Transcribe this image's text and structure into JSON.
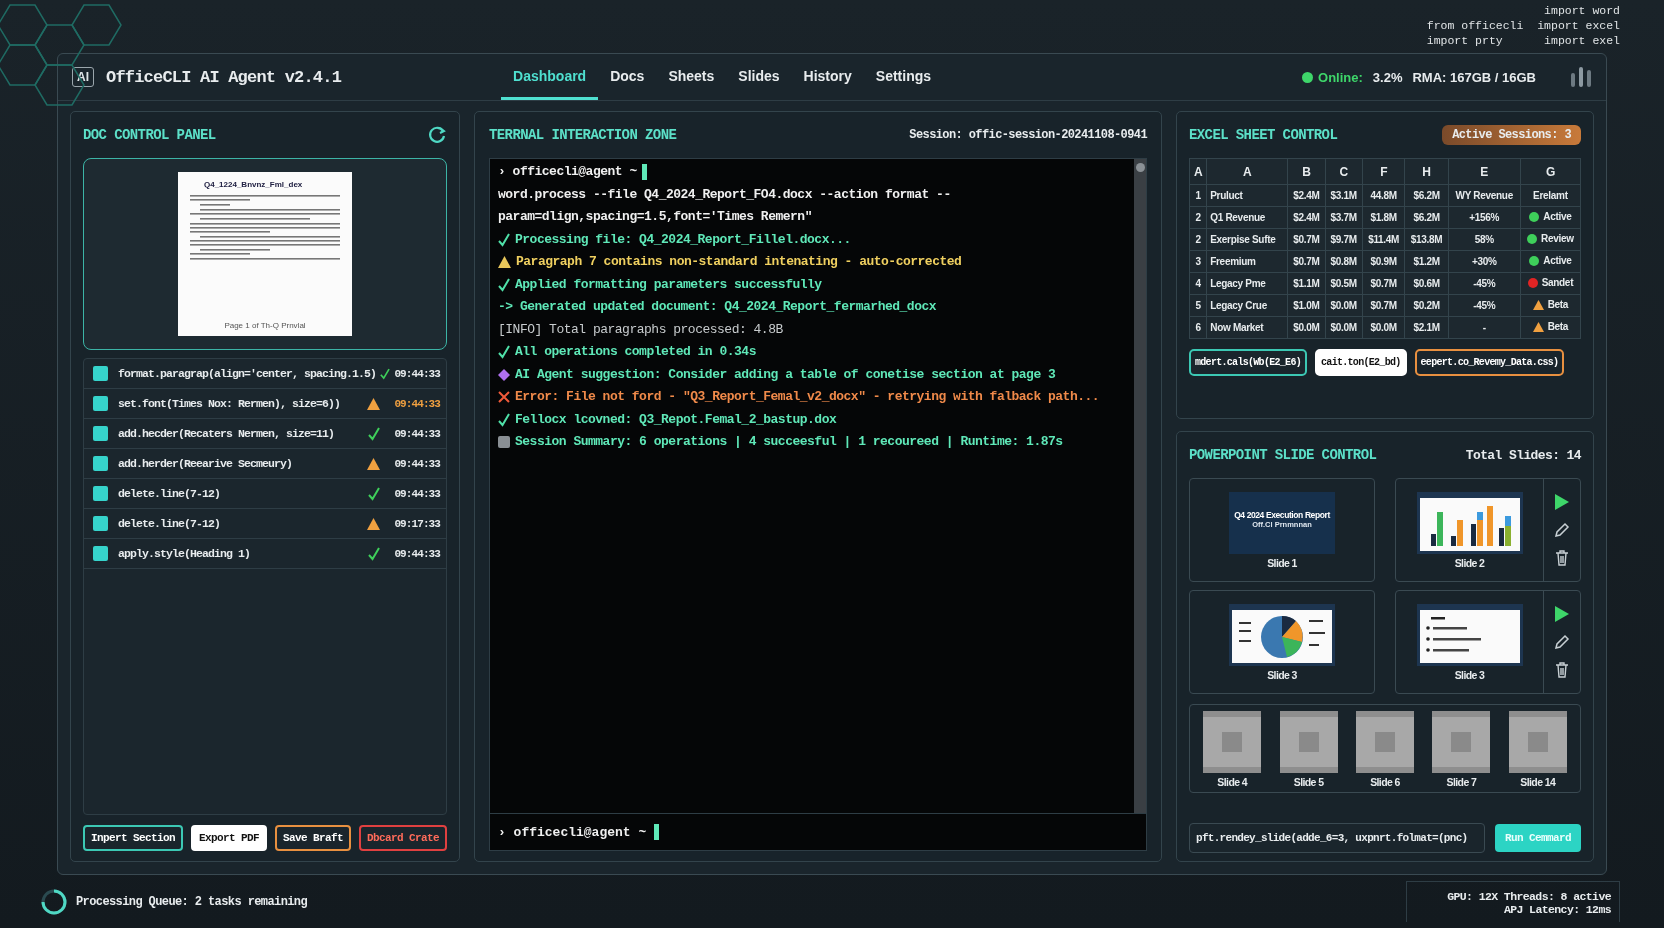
{
  "code_snippet": [
    "import word",
    "from officecli  import excel",
    "import prty      import exel"
  ],
  "header": {
    "logo": "AI",
    "title": "OfficeCLI AI Agent v2.4.1",
    "tabs": [
      {
        "label": "Dashboard",
        "selected": true
      },
      {
        "label": "Docs",
        "selected": false
      },
      {
        "label": "Sheets",
        "selected": false
      },
      {
        "label": "Slides",
        "selected": false
      },
      {
        "label": "History",
        "selected": false
      },
      {
        "label": "Settings",
        "selected": false
      }
    ],
    "status": {
      "online": true,
      "label": "Online:",
      "cpu": "3.2%",
      "ram": "RMA: 167GB / 16GB"
    }
  },
  "doc_panel": {
    "title": "DOC CONTROL PANEL",
    "preview": {
      "title": "Q4_1224_Bnvnz_Fml_dex",
      "footer": "Page 1 of Th-Q Prnvlal"
    },
    "operations": [
      {
        "command": "format.paragrap(align='center, spacing.1.5)",
        "kind": "success",
        "time": "09:44:33",
        "highlighted": false
      },
      {
        "command": "set.font(Times Nox: Rermen), size=6))",
        "kind": "warning",
        "time": "09:44:33",
        "highlighted": true
      },
      {
        "command": "add.hecder(Recaters Nermen, size=11)",
        "kind": "success",
        "time": "09:44:33",
        "highlighted": false
      },
      {
        "command": "add.herder(Reearive Secmeury)",
        "kind": "warning",
        "time": "09:44:33",
        "highlighted": false
      },
      {
        "command": "delete.line(7-12)",
        "kind": "success",
        "time": "09:44:33",
        "highlighted": false
      },
      {
        "command": "delete.line(7-12)",
        "kind": "warning",
        "time": "09:17:33",
        "highlighted": false
      },
      {
        "command": "apply.style(Heading 1)",
        "kind": "success",
        "time": "09:44:33",
        "highlighted": false
      }
    ],
    "buttons": [
      {
        "label": "Inpert Section",
        "kind": "teal"
      },
      {
        "label": "Export PDF",
        "kind": "white"
      },
      {
        "label": "Save Braft",
        "kind": "orange"
      },
      {
        "label": "Dbcard Crate",
        "kind": "red"
      }
    ]
  },
  "terminal": {
    "title": "TERRNAL INTERACTION ZONE",
    "session": "Session: offic-session-20241108-0941",
    "prompt": "› officecli@agent ~",
    "lines": [
      {
        "kind": "command",
        "text": "word.process --file Q4_2024_Report_FO4.docx --action format --param=dlign,spacing=1.5,font='Times Remern\""
      },
      {
        "kind": "success",
        "text": "Processing file: Q4_2024_Report_Fillel.docx..."
      },
      {
        "kind": "warning",
        "text": "Paragraph 7 contains non-standard intenating - auto-corrected"
      },
      {
        "kind": "success",
        "text": "Applied formatting parameters successfully"
      },
      {
        "kind": "arrow",
        "text": "-> Generated updated document: Q4_2024_Report_fermarhed_docx"
      },
      {
        "kind": "info",
        "text": "[INFO] Total paragraphs processed: 4.8B"
      },
      {
        "kind": "success",
        "text": "All operations completed in 0.34s"
      },
      {
        "kind": "suggestion",
        "text": "AI Agent suggestion: Consider adding a table of conetise section at page 3"
      },
      {
        "kind": "error",
        "text": "Error: File not ford - \"Q3_Report_Femal_v2_docx\" - retrying with falback path..."
      },
      {
        "kind": "success",
        "text": "Fellocx lcovned: Q3_Repot.Femal_2_bastup.dox"
      },
      {
        "kind": "summary",
        "text": "Session Summary: 6 operations | 4 succeesful | 1 recoureed  | Runtime: 1.87s"
      }
    ],
    "bottom_prompt": "› officecli@agent ~"
  },
  "excel_panel": {
    "title": "EXCEL SHEET CONTROL",
    "badge": "Active Sessions:  3",
    "columns": [
      "A",
      "A",
      "B",
      "C",
      "F",
      "H",
      "E",
      "G"
    ],
    "rows": [
      {
        "cells": [
          "1",
          "Pruluct",
          "$2.4M",
          "$3.1M",
          "44.8M",
          "$6.2M",
          "WY Revenue"
        ],
        "status": {
          "label": "Erelamt",
          "kind": "none"
        }
      },
      {
        "cells": [
          "2",
          "Q1 Revenue",
          "$2.4M",
          "$3.7M",
          "$1.8M",
          "$6.2M",
          "+156%"
        ],
        "status": {
          "label": "Active",
          "kind": "dot",
          "color": "#3ecf5a"
        }
      },
      {
        "cells": [
          "2",
          "Exerpise Sufte",
          "$0.7M",
          "$9.7M",
          "$11.4M",
          "$13.8M",
          "58%"
        ],
        "status": {
          "label": "Review",
          "kind": "dot",
          "color": "#3ecf5a"
        }
      },
      {
        "cells": [
          "3",
          "Freemium",
          "$0.7M",
          "$0.8M",
          "$0.9M",
          "$1.2M",
          "+30%"
        ],
        "status": {
          "label": "Active",
          "kind": "dot",
          "color": "#3ecf5a"
        }
      },
      {
        "cells": [
          "4",
          "Legacy Pme",
          "$1.1M",
          "$0.5M",
          "$0.7M",
          "$0.6M",
          "-45%"
        ],
        "status": {
          "label": "Sandet",
          "kind": "dot",
          "color": "#e02424"
        }
      },
      {
        "cells": [
          "5",
          "Legacy Crue",
          "$1.0M",
          "$0.0M",
          "$0.7M",
          "$0.2M",
          "-45%"
        ],
        "status": {
          "label": "Beta",
          "kind": "triangle",
          "color": "#f0a040"
        }
      },
      {
        "cells": [
          "6",
          "Now Market",
          "$0.0M",
          "$0.0M",
          "$0.0M",
          "$2.1M",
          "-"
        ],
        "status": {
          "label": "Beta",
          "kind": "triangle",
          "color": "#f0a040"
        }
      }
    ],
    "buttons": [
      {
        "label": "mdert.cals(Wb(E2_E6)",
        "kind": "teal"
      },
      {
        "label": "cait.ton(E2_bd)",
        "kind": "white"
      },
      {
        "label": "eepert.co_Revemy_Data.css)",
        "kind": "orange"
      }
    ]
  },
  "ppt_panel": {
    "title": "POWERPOINT SLIDE CONTROL",
    "total": "Total Slides: 14",
    "slides": [
      {
        "label": "Slide 1",
        "kind": "title",
        "heading": "Q4 2024 Execution Report",
        "subheading": "Off.Cl Prnmnnan",
        "actions": false
      },
      {
        "label": "Slide 2",
        "kind": "bar",
        "actions": true
      },
      {
        "label": "Slide 3",
        "kind": "pie",
        "actions": false
      },
      {
        "label": "Slide 3",
        "kind": "bullets",
        "actions": true
      }
    ],
    "strip": [
      "Slide 4",
      "Slide 5",
      "Slide 6",
      "Slide 7",
      "Slide 14"
    ],
    "command": "pft.rendey_slide(adde_6=3, uxpnrt.folmat=(pnc)",
    "run_button": "Run Cemmard"
  },
  "footer": {
    "queue": "Processing Queue: 2 tasks remaining",
    "stats": "GPU: 12X   Threads: 8 active",
    "latency": "APJ Latency: 12ms"
  }
}
